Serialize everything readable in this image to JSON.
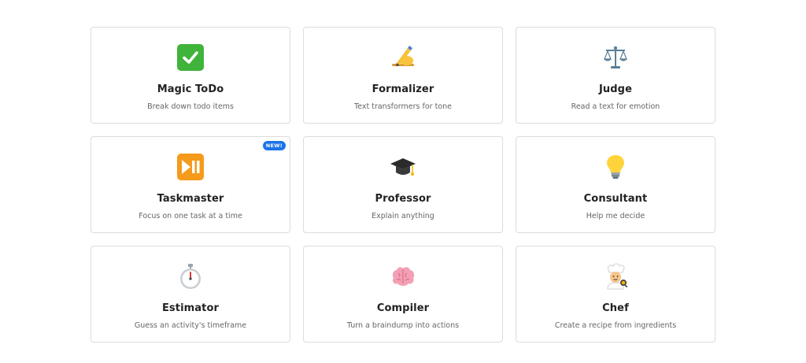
{
  "cards": [
    {
      "icon": "check-mark-button-icon",
      "title": "Magic ToDo",
      "desc": "Break down todo items"
    },
    {
      "icon": "writing-hand-icon",
      "title": "Formalizer",
      "desc": "Text transformers for tone"
    },
    {
      "icon": "balance-scale-icon",
      "title": "Judge",
      "desc": "Read a text for emotion"
    },
    {
      "icon": "play-pause-icon",
      "title": "Taskmaster",
      "desc": "Focus on one task at a time",
      "badge": "NEW!"
    },
    {
      "icon": "graduation-cap-icon",
      "title": "Professor",
      "desc": "Explain anything"
    },
    {
      "icon": "light-bulb-icon",
      "title": "Consultant",
      "desc": "Help me decide"
    },
    {
      "icon": "stopwatch-icon",
      "title": "Estimator",
      "desc": "Guess an activity's timeframe"
    },
    {
      "icon": "brain-icon",
      "title": "Compiler",
      "desc": "Turn a braindump into actions"
    },
    {
      "icon": "cook-icon",
      "title": "Chef",
      "desc": "Create a recipe from ingredients"
    }
  ],
  "colors": {
    "border": "#dcdcdc",
    "badge": "#1a73e8",
    "check_green": "#3fb33a",
    "play_orange": "#f59a1b"
  }
}
